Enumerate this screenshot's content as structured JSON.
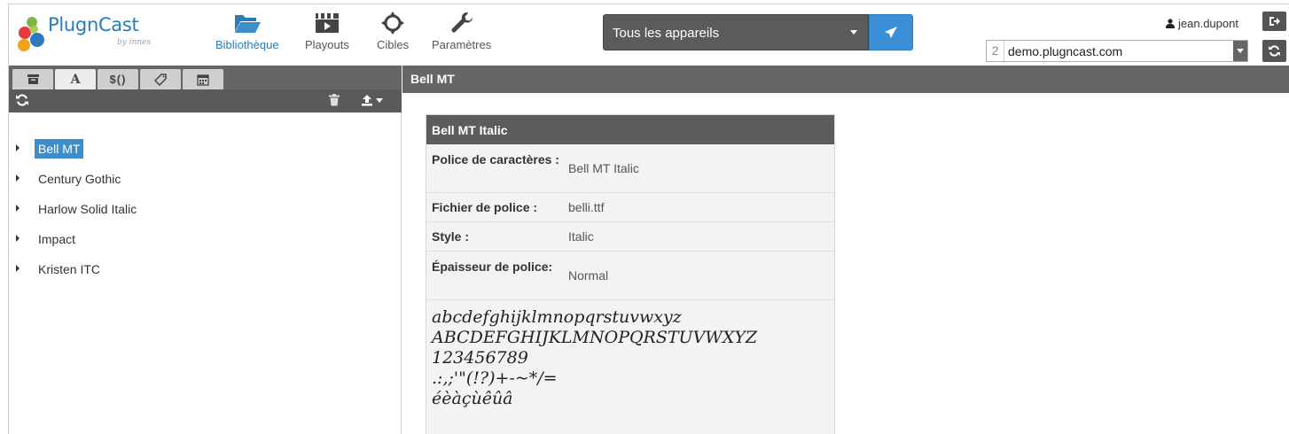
{
  "app": {
    "logo_text": "PlugnCast",
    "logo_sub": "by innes"
  },
  "nav": [
    {
      "label": "Bibliothèque",
      "icon": "folder-open-icon",
      "active": true
    },
    {
      "label": "Playouts",
      "icon": "clapperboard-icon"
    },
    {
      "label": "Cibles",
      "icon": "crosshair-icon"
    },
    {
      "label": "Paramètres",
      "icon": "wrench-icon"
    }
  ],
  "device_select": {
    "value": "Tous les appareils"
  },
  "user": {
    "name": "jean.dupont"
  },
  "server": {
    "index": "2",
    "host": "demo.plugncast.com"
  },
  "left": {
    "tabs": [
      {
        "icon": "archive-icon"
      },
      {
        "label": "A",
        "icon": "font-icon",
        "active": true
      },
      {
        "label": "$()",
        "icon": "variable-icon"
      },
      {
        "icon": "tag-icon"
      },
      {
        "icon": "calendar-icon"
      }
    ],
    "tree": [
      {
        "label": "Bell MT",
        "selected": true
      },
      {
        "label": "Century Gothic"
      },
      {
        "label": "Harlow Solid Italic"
      },
      {
        "label": "Impact"
      },
      {
        "label": "Kristen ITC"
      }
    ]
  },
  "right": {
    "title": "Bell MT",
    "card": {
      "title": "Bell MT Italic",
      "rows": [
        {
          "key": "Police de caractères :",
          "value": "Bell MT Italic"
        },
        {
          "key": "Fichier de police :",
          "value": "belli.ttf"
        },
        {
          "key": "Style :",
          "value": "Italic"
        },
        {
          "key": "Épaisseur de police:",
          "value": "Normal"
        }
      ],
      "sample_lines": [
        "abcdefghijklmnopqrstuvwxyz",
        "ABCDEFGHIJKLMNOPQRSTUVWXYZ",
        "123456789",
        ".:,;'\"(!?)+-~*/=",
        "éèàçùêûâ"
      ]
    }
  },
  "colors": {
    "brand_blue": "#2a7cb8",
    "selection_blue": "#3b8ec9",
    "dark_bar": "#666666"
  }
}
